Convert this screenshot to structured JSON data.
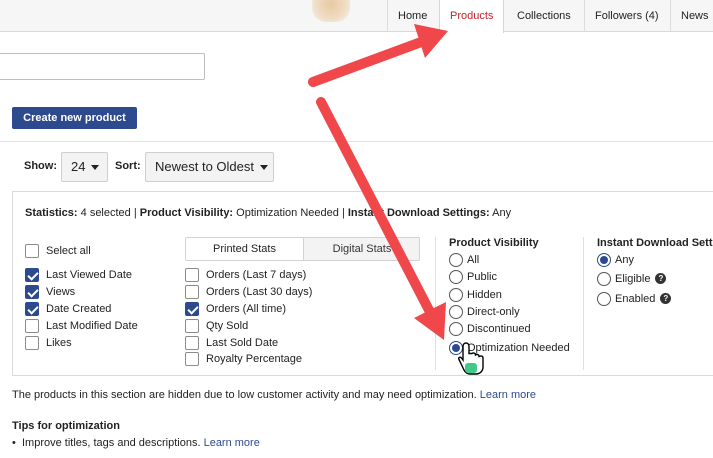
{
  "nav": {
    "tabs": [
      {
        "label": "Home"
      },
      {
        "label": "Products"
      },
      {
        "label": "Collections"
      },
      {
        "label": "Followers (4)"
      },
      {
        "label": "News"
      }
    ],
    "active_tab": "Products"
  },
  "search": {
    "value": ""
  },
  "create_button": "Create new product",
  "controls": {
    "show_label": "Show:",
    "show_value": "24",
    "sort_label": "Sort:",
    "sort_value": "Newest to Oldest"
  },
  "stats": {
    "summary": {
      "stats_label": "Statistics:",
      "stats_value": "4 selected",
      "sep1": "|",
      "visibility_label": "Product Visibility:",
      "visibility_value": "Optimization Needed",
      "sep2": "|",
      "download_label": "Instant Download Settings:",
      "download_value": "Any"
    },
    "select_all": "Select all",
    "left_options": [
      {
        "label": "Last Viewed Date",
        "checked": true
      },
      {
        "label": "Views",
        "checked": true
      },
      {
        "label": "Date Created",
        "checked": true
      },
      {
        "label": "Last Modified Date",
        "checked": false
      },
      {
        "label": "Likes",
        "checked": false
      }
    ],
    "tabs": {
      "printed": "Printed Stats",
      "digital": "Digital Stats"
    },
    "printed_options": [
      {
        "label": "Orders (Last 7 days)",
        "checked": false
      },
      {
        "label": "Orders (Last 30 days)",
        "checked": false
      },
      {
        "label": "Orders (All time)",
        "checked": true
      },
      {
        "label": "Qty Sold",
        "checked": false
      },
      {
        "label": "Last Sold Date",
        "checked": false
      },
      {
        "label": "Royalty Percentage",
        "checked": false
      }
    ],
    "visibility": {
      "title": "Product Visibility",
      "options": [
        {
          "label": "All",
          "selected": false
        },
        {
          "label": "Public",
          "selected": false
        },
        {
          "label": "Hidden",
          "selected": false
        },
        {
          "label": "Direct-only",
          "selected": false
        },
        {
          "label": "Discontinued",
          "selected": false
        },
        {
          "label": "Optimization Needed",
          "selected": true
        }
      ]
    },
    "download": {
      "title": "Instant Download Setti",
      "options": [
        {
          "label": "Any",
          "selected": true,
          "help": false
        },
        {
          "label": "Eligible",
          "selected": false,
          "help": true
        },
        {
          "label": "Enabled",
          "selected": false,
          "help": true
        }
      ]
    }
  },
  "info": {
    "text": "The products in this section are hidden due to low customer activity and may need optimization.",
    "link": "Learn more"
  },
  "tips": {
    "title": "Tips for optimization",
    "bullet": "•",
    "item": "Improve titles, tags and descriptions.",
    "item_link": "Learn more"
  },
  "colors": {
    "accent": "#2e4a8f",
    "active_tab": "#c3242b",
    "annotation_arrow": "#f0474b"
  }
}
